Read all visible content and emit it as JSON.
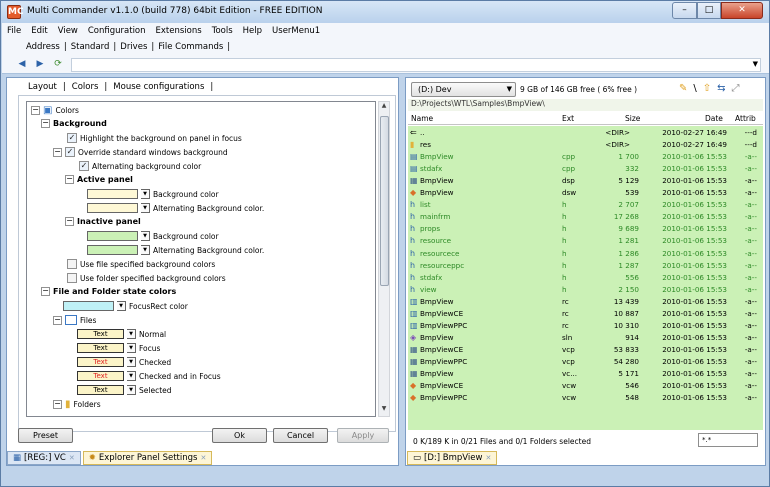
{
  "window": {
    "title": "Multi Commander v1.1.0 (build 778) 64bit Edition - FREE EDITION",
    "app_icon": "MC",
    "buttons": [
      "–",
      "□",
      "✕"
    ]
  },
  "menu": [
    "File",
    "Edit",
    "View",
    "Configuration",
    "Extensions",
    "Tools",
    "Help",
    "UserMenu1"
  ],
  "toolbar_tabs": [
    "Address",
    "Standard",
    "Drives",
    "File Commands"
  ],
  "left": {
    "tabs": [
      "Layout",
      "Colors",
      "Mouse configurations"
    ],
    "tree": {
      "root": "Colors",
      "background": "Background",
      "highlight": "Highlight the background on panel in focus",
      "override": "Override standard windows background",
      "alternating": "Alternating background color",
      "active_panel": "Active panel",
      "bg_color": "Background color",
      "alt_bg_color": "Alternating Background color.",
      "inactive_panel": "Inactive panel",
      "bg_color2": "Background color",
      "alt_bg_color2": "Alternating Background color.",
      "use_file": "Use file specified background colors",
      "use_folder": "Use folder specified background colors",
      "file_folder_state": "File and Folder state colors",
      "focusrect": "FocusRect color",
      "files": "Files",
      "text": "Text",
      "normal": "Normal",
      "focus": "Focus",
      "checked": "Checked",
      "checked_focus": "Checked and in Focus",
      "selected": "Selected",
      "folders": "Folders"
    },
    "buttons": {
      "preset": "Preset",
      "ok": "Ok",
      "cancel": "Cancel",
      "apply": "Apply"
    },
    "panel_tabs": [
      {
        "label": "[REG:] VC"
      },
      {
        "label": "Explorer Panel Settings"
      }
    ]
  },
  "right": {
    "drive": "(D:) Dev",
    "free": "9 GB of 146 GB free ( 6% free )",
    "path": "D:\\Projects\\WTL\\Samples\\BmpView\\",
    "columns": {
      "name": "Name",
      "ext": "Ext",
      "size": "Size",
      "date": "Date",
      "attrib": "Attrib"
    },
    "files": [
      {
        "name": "..",
        "ext": "",
        "size": "<DIR>",
        "date": "2010-02-27 16:49",
        "attrib": "---d",
        "icon": "up-icon",
        "green": false
      },
      {
        "name": "res",
        "ext": "",
        "size": "<DIR>",
        "date": "2010-02-27 16:49",
        "attrib": "---d",
        "icon": "folder-icon",
        "green": false
      },
      {
        "name": "BmpView",
        "ext": "cpp",
        "size": "1 700",
        "date": "2010-01-06 15:53",
        "attrib": "-a--",
        "icon": "cpp-icon",
        "green": true
      },
      {
        "name": "stdafx",
        "ext": "cpp",
        "size": "332",
        "date": "2010-01-06 15:53",
        "attrib": "-a--",
        "icon": "cpp-icon",
        "green": true
      },
      {
        "name": "BmpView",
        "ext": "dsp",
        "size": "5 129",
        "date": "2010-01-06 15:53",
        "attrib": "-a--",
        "icon": "project-icon",
        "green": false
      },
      {
        "name": "BmpView",
        "ext": "dsw",
        "size": "539",
        "date": "2010-01-06 15:53",
        "attrib": "-a--",
        "icon": "workspace-icon",
        "green": false
      },
      {
        "name": "list",
        "ext": "h",
        "size": "2 707",
        "date": "2010-01-06 15:53",
        "attrib": "-a--",
        "icon": "header-icon",
        "green": true
      },
      {
        "name": "mainfrm",
        "ext": "h",
        "size": "17 268",
        "date": "2010-01-06 15:53",
        "attrib": "-a--",
        "icon": "header-icon",
        "green": true
      },
      {
        "name": "props",
        "ext": "h",
        "size": "9 689",
        "date": "2010-01-06 15:53",
        "attrib": "-a--",
        "icon": "header-icon",
        "green": true
      },
      {
        "name": "resource",
        "ext": "h",
        "size": "1 281",
        "date": "2010-01-06 15:53",
        "attrib": "-a--",
        "icon": "header-icon",
        "green": true
      },
      {
        "name": "resourcece",
        "ext": "h",
        "size": "1 286",
        "date": "2010-01-06 15:53",
        "attrib": "-a--",
        "icon": "header-icon",
        "green": true
      },
      {
        "name": "resourceppc",
        "ext": "h",
        "size": "1 287",
        "date": "2010-01-06 15:53",
        "attrib": "-a--",
        "icon": "header-icon",
        "green": true
      },
      {
        "name": "stdafx",
        "ext": "h",
        "size": "556",
        "date": "2010-01-06 15:53",
        "attrib": "-a--",
        "icon": "header-icon",
        "green": true
      },
      {
        "name": "view",
        "ext": "h",
        "size": "2 150",
        "date": "2010-01-06 15:53",
        "attrib": "-a--",
        "icon": "header-icon",
        "green": true
      },
      {
        "name": "BmpView",
        "ext": "rc",
        "size": "13 439",
        "date": "2010-01-06 15:53",
        "attrib": "-a--",
        "icon": "resource-icon",
        "green": false
      },
      {
        "name": "BmpViewCE",
        "ext": "rc",
        "size": "10 887",
        "date": "2010-01-06 15:53",
        "attrib": "-a--",
        "icon": "resource-icon",
        "green": false
      },
      {
        "name": "BmpViewPPC",
        "ext": "rc",
        "size": "10 310",
        "date": "2010-01-06 15:53",
        "attrib": "-a--",
        "icon": "resource-icon",
        "green": false
      },
      {
        "name": "BmpView",
        "ext": "sln",
        "size": "914",
        "date": "2010-01-06 15:53",
        "attrib": "-a--",
        "icon": "solution-icon",
        "green": false
      },
      {
        "name": "BmpViewCE",
        "ext": "vcp",
        "size": "53 833",
        "date": "2010-01-06 15:53",
        "attrib": "-a--",
        "icon": "project-icon",
        "green": false
      },
      {
        "name": "BmpViewPPC",
        "ext": "vcp",
        "size": "54 280",
        "date": "2010-01-06 15:53",
        "attrib": "-a--",
        "icon": "project-icon",
        "green": false
      },
      {
        "name": "BmpView",
        "ext": "vc...",
        "size": "5 171",
        "date": "2010-01-06 15:53",
        "attrib": "-a--",
        "icon": "project-icon",
        "green": false
      },
      {
        "name": "BmpViewCE",
        "ext": "vcw",
        "size": "546",
        "date": "2010-01-06 15:53",
        "attrib": "-a--",
        "icon": "workspace-icon",
        "green": false
      },
      {
        "name": "BmpViewPPC",
        "ext": "vcw",
        "size": "548",
        "date": "2010-01-06 15:53",
        "attrib": "-a--",
        "icon": "workspace-icon",
        "green": false
      }
    ],
    "status": "0 K/189 K in 0/21 Files and 0/1 Folders selected",
    "filter": "*.*",
    "tab": "[D:] BmpView"
  }
}
